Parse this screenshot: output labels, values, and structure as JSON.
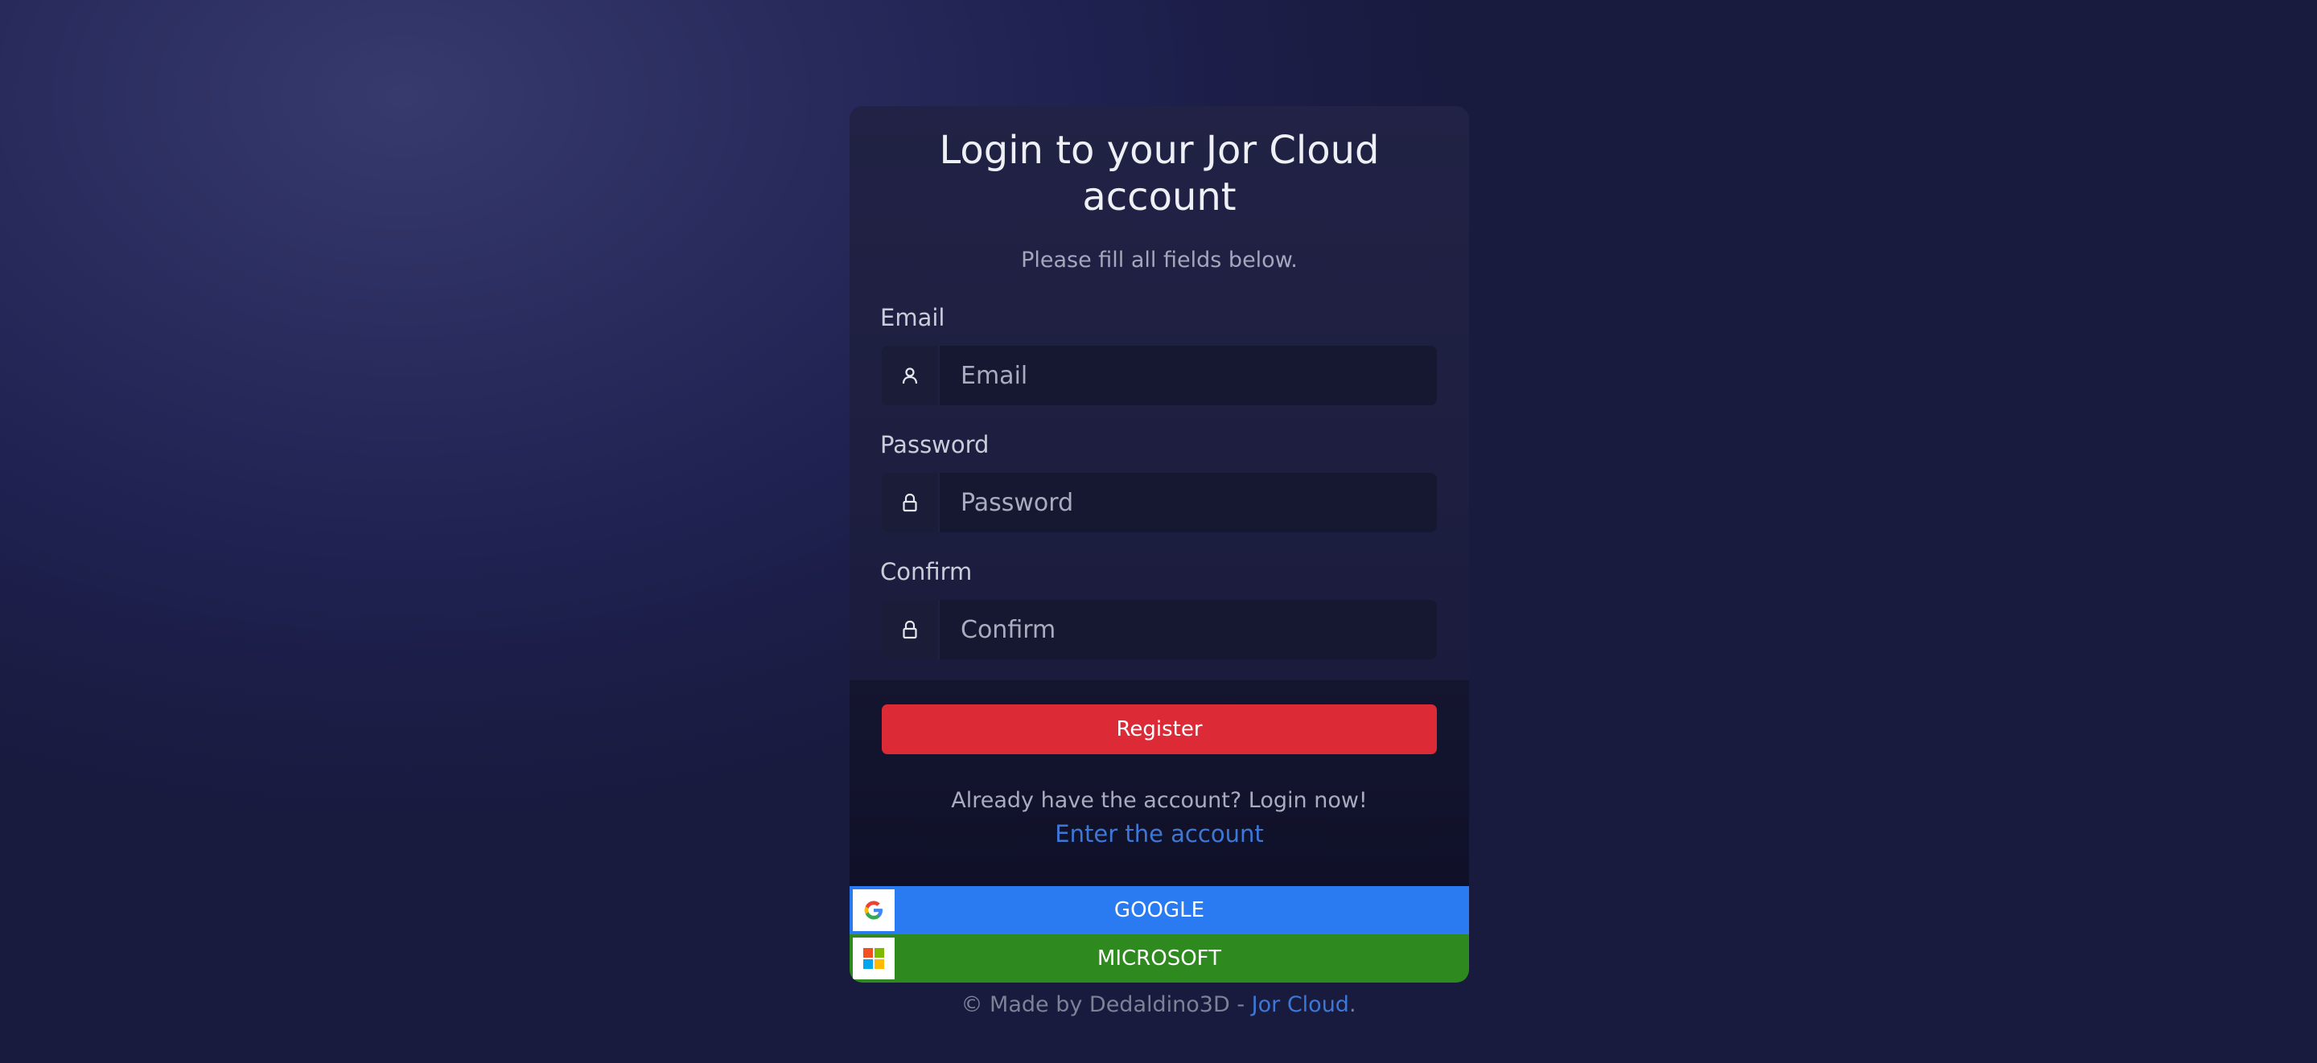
{
  "form": {
    "title": "Login to your Jor Cloud account",
    "subtitle": "Please fill all fields below.",
    "fields": [
      {
        "label": "Email",
        "placeholder": "Email",
        "icon": "user-icon"
      },
      {
        "label": "Password",
        "placeholder": "Password",
        "icon": "lock-icon"
      },
      {
        "label": "Confirm",
        "placeholder": "Confirm",
        "icon": "lock-icon"
      }
    ],
    "register_label": "Register",
    "already_text": "Already have the account? Login now!",
    "enter_link": "Enter the account"
  },
  "oauth": {
    "google_label": "GOOGLE",
    "microsoft_label": "MICROSOFT"
  },
  "footer": {
    "text": "© Made by Dedaldino3D - ",
    "link": "Jor Cloud",
    "suffix": "."
  },
  "colors": {
    "register": "#dc2a37",
    "google": "#2a7af2",
    "microsoft": "#2e8a1f",
    "link": "#3d78d8"
  }
}
